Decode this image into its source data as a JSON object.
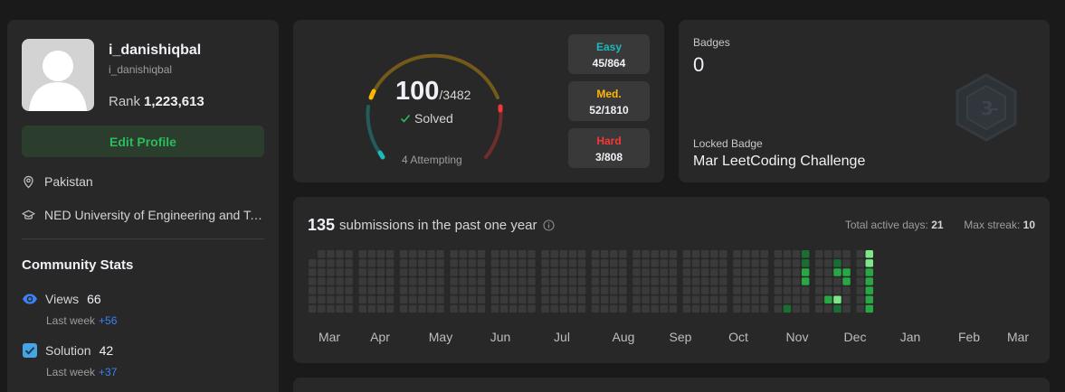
{
  "profile": {
    "username": "i_danishiqbal",
    "handle": "i_danishiqbal",
    "rank_label": "Rank",
    "rank_value": "1,223,613",
    "edit_button": "Edit Profile",
    "location": "Pakistan",
    "education": "NED University of Engineering and Te..."
  },
  "community": {
    "title": "Community Stats",
    "views": {
      "label": "Views",
      "value": "66",
      "last_week_label": "Last week",
      "delta": "+56"
    },
    "solution": {
      "label": "Solution",
      "value": "42",
      "last_week_label": "Last week",
      "delta": "+37"
    }
  },
  "solved": {
    "count": "100",
    "total": "/3482",
    "label": "Solved",
    "attempting": "4 Attempting",
    "easy": {
      "label": "Easy",
      "count": "45/864",
      "color": "#1cbaba"
    },
    "medium": {
      "label": "Med.",
      "count": "52/1810",
      "color": "#ffb700"
    },
    "hard": {
      "label": "Hard",
      "count": "3/808",
      "color": "#f63737"
    }
  },
  "badges": {
    "label": "Badges",
    "count": "0",
    "locked_label": "Locked Badge",
    "locked_name": "Mar LeetCoding Challenge",
    "badge_icon": "locked-badge-icon"
  },
  "submissions": {
    "count": "135",
    "title": "submissions in the past one year",
    "active_days_label": "Total active days:",
    "active_days": "21",
    "max_streak_label": "Max streak:",
    "max_streak": "10",
    "months": [
      "Mar",
      "Apr",
      "May",
      "Jun",
      "Jul",
      "Aug",
      "Sep",
      "Oct",
      "Nov",
      "Dec",
      "Jan",
      "Feb",
      "Mar"
    ]
  },
  "colors": {
    "accent_green": "#2cbb5d",
    "link_blue": "#3b82f6",
    "card_bg": "#282828",
    "page_bg": "#1a1a1a"
  }
}
